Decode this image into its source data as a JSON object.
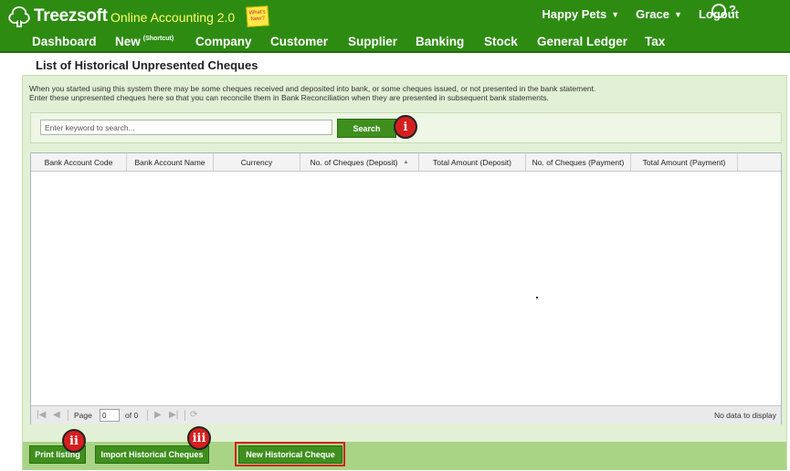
{
  "header": {
    "logo_text": "Treezsoft",
    "app_name": "Online Accounting 2.0",
    "sticky_note": "What's New?",
    "company": "Happy Pets",
    "user": "Grace",
    "logout": "Logout",
    "help": "?"
  },
  "nav": {
    "items": [
      {
        "label": "Dashboard"
      },
      {
        "label": "New",
        "sup": "(Shortcut)"
      },
      {
        "label": "Company"
      },
      {
        "label": "Customer"
      },
      {
        "label": "Supplier"
      },
      {
        "label": "Banking"
      },
      {
        "label": "Stock"
      },
      {
        "label": "General Ledger"
      },
      {
        "label": "Tax"
      }
    ]
  },
  "page": {
    "title": "List of Historical Unpresented Cheques",
    "intro_line1": "When you started using this system there may be some cheques received and deposited into bank, or some cheques issued, or not presented in the bank statement.",
    "intro_line2": "Enter these unpresented cheques here so that you can reconcile them in Bank Reconciliation when they are presented in subsequent bank statements."
  },
  "search": {
    "placeholder": "Enter keyword to search...",
    "button": "Search"
  },
  "markers": {
    "one": "i",
    "two": "ii",
    "three": "iii"
  },
  "grid": {
    "columns": [
      "Bank Account Code",
      "Bank Account Name",
      "Currency",
      "No. of Cheques (Deposit)",
      "Total Amount (Deposit)",
      "No. of Cheques (Payment)",
      "Total Amount (Payment)"
    ],
    "sort_indicator": "▲",
    "pager": {
      "page_label": "Page",
      "page_value": "0",
      "of_label": "of 0",
      "empty_message": "No data to display"
    }
  },
  "actions": {
    "print": "Print listing",
    "import": "Import Historical Cheques",
    "new": "New Historical Cheque"
  },
  "colors": {
    "header_green": "#2e8b12",
    "app_name_yellow": "#ffff66",
    "button_green": "#3f8f1e",
    "panel_green": "#e2f0d5",
    "footer_green": "#a9d486",
    "marker_red": "#d41f1f"
  }
}
